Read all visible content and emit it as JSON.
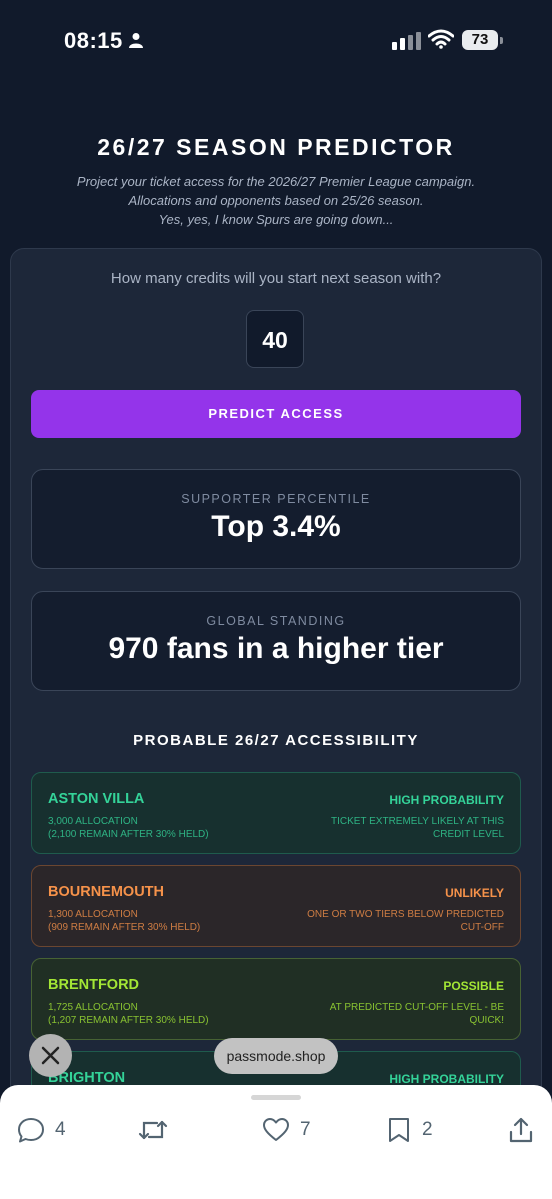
{
  "status_bar": {
    "time": "08:15",
    "battery": "73"
  },
  "header": {
    "title": "26/27 SEASON PREDICTOR",
    "subtitle_lines": [
      "Project your ticket access for the 2026/27 Premier League campaign.",
      "Allocations and opponents based on 25/26 season.",
      "Yes, yes, I know Spurs are going down..."
    ]
  },
  "credits": {
    "question": "How many credits will you start next season with?",
    "value": "40"
  },
  "predict_button": "PREDICT ACCESS",
  "stats": [
    {
      "label": "SUPPORTER PERCENTILE",
      "value": "Top 3.4%"
    },
    {
      "label": "GLOBAL STANDING",
      "value": "970 fans in a higher tier"
    }
  ],
  "section_title": "PROBABLE 26/27 ACCESSIBILITY",
  "clubs": [
    {
      "name": "ASTON VILLA",
      "alloc1": "3,000 ALLOCATION",
      "alloc2": "(2,100 REMAIN AFTER 30% HELD)",
      "probability": "HIGH PROBABILITY",
      "note": "TICKET EXTREMELY LIKELY AT THIS CREDIT LEVEL"
    },
    {
      "name": "BOURNEMOUTH",
      "alloc1": "1,300 ALLOCATION",
      "alloc2": "(909 REMAIN AFTER 30% HELD)",
      "probability": "UNLIKELY",
      "note": "ONE OR TWO TIERS BELOW PREDICTED CUT-OFF"
    },
    {
      "name": "BRENTFORD",
      "alloc1": "1,725 ALLOCATION",
      "alloc2": "(1,207 REMAIN AFTER 30% HELD)",
      "probability": "POSSIBLE",
      "note": "AT PREDICTED CUT-OFF LEVEL - BE QUICK!"
    },
    {
      "name": "BRIGHTON",
      "probability": "HIGH PROBABILITY"
    }
  ],
  "overlay": {
    "url": "passmode.shop"
  },
  "actions": {
    "replies": "4",
    "likes": "7",
    "bookmarks": "2"
  },
  "colors": {
    "accent": "#9434ea",
    "high": "#34d399",
    "unlikely": "#f6924a",
    "possible": "#a3e635"
  }
}
